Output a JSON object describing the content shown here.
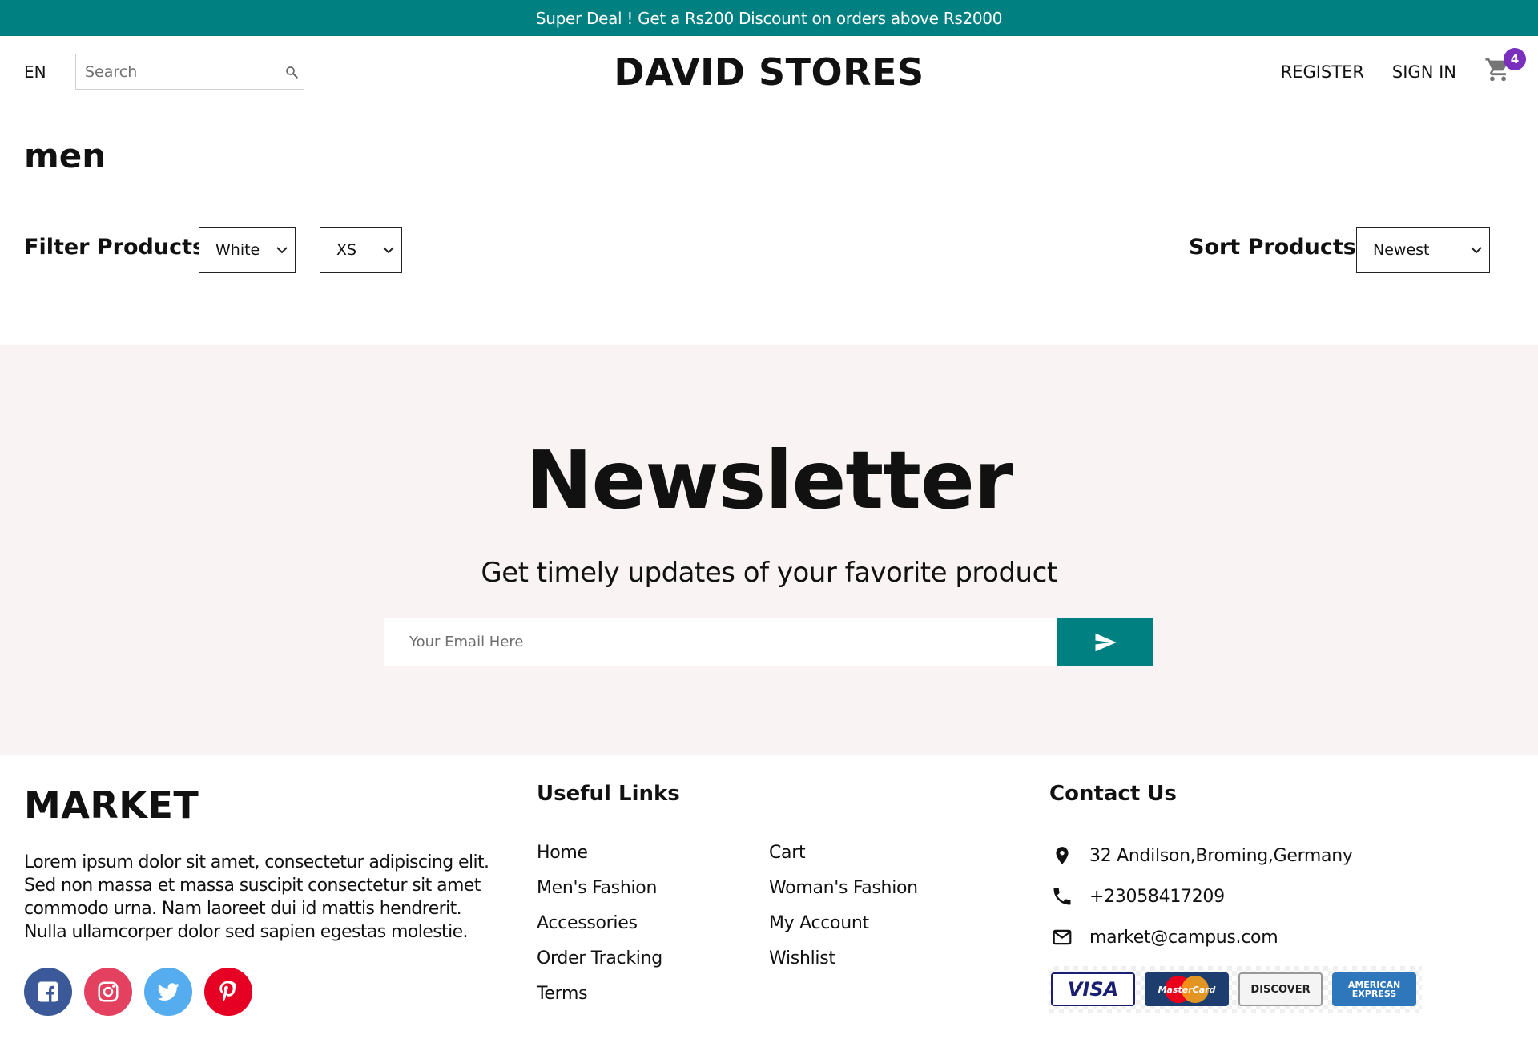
{
  "announcement": {
    "text": "Super Deal ! Get a Rs200 Discount on orders above Rs2000"
  },
  "header": {
    "language": "EN",
    "search_placeholder": "Search",
    "logo": "DAVID STORES",
    "register_label": "REGISTER",
    "signin_label": "SIGN IN",
    "cart_count": "4",
    "cart_icon": "shopping-cart-icon",
    "badge_color": "#7b2fbe"
  },
  "category": {
    "title": "men"
  },
  "filters": {
    "label": "Filter Products",
    "color_selected": "White",
    "size_selected": "XS",
    "sort_label": "Sort Products",
    "sort_selected": "Newest"
  },
  "newsletter": {
    "title": "Newsletter",
    "description": "Get timely updates of your favorite product",
    "email_placeholder": "Your Email Here",
    "send_icon": "send-icon",
    "background": "#f9f4f3",
    "accent": "#008080"
  },
  "footer": {
    "brand": "MARKET",
    "about": "Lorem ipsum dolor sit amet, consectetur adipiscing elit. Sed non massa et massa suscipit consectetur sit amet commodo urna. Nam laoreet dui id mattis hendrerit. Nulla ullamcorper dolor sed sapien egestas molestie.",
    "socials": [
      {
        "name": "facebook-icon",
        "color": "#3b5998"
      },
      {
        "name": "instagram-icon",
        "color": "#e4405f"
      },
      {
        "name": "twitter-icon",
        "color": "#55acee"
      },
      {
        "name": "pinterest-icon",
        "color": "#e60023"
      }
    ],
    "links_title": "Useful Links",
    "links": [
      "Home",
      "Cart",
      "Men's Fashion",
      "Woman's Fashion",
      "Accessories",
      "My Account",
      "Order Tracking",
      "Wishlist",
      "Terms"
    ],
    "contact_title": "Contact Us",
    "contact": {
      "address": "32 Andilson,Broming,Germany",
      "phone": "+23058417209",
      "email": "market@campus.com"
    },
    "payments": [
      "VISA",
      "MasterCard",
      "DISCOVER",
      "AMERICAN EXPRESS"
    ]
  }
}
